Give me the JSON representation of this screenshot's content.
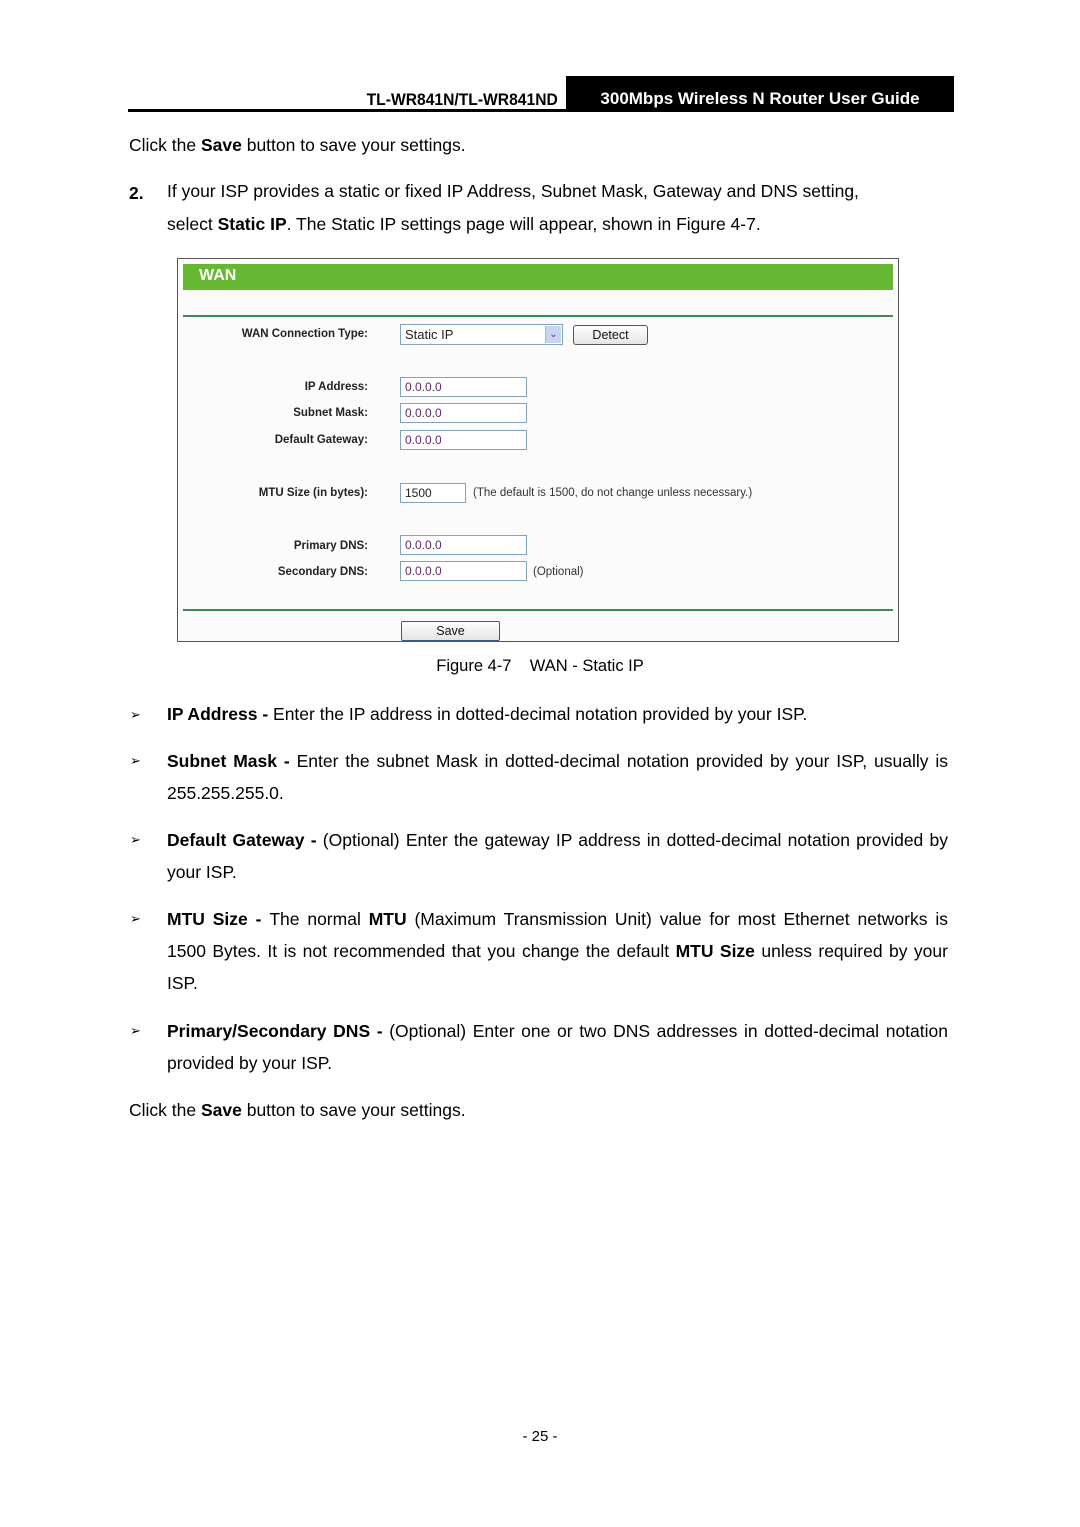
{
  "header": {
    "model": "TL-WR841N/TL-WR841ND",
    "guide_title": "300Mbps Wireless N Router User Guide"
  },
  "intro": {
    "save_line": [
      "Click the ",
      "Save",
      " button to save your settings."
    ],
    "step_number": "2.",
    "step_text_1": "If your ISP provides a static or fixed IP Address, Subnet Mask, Gateway and DNS setting,",
    "step_text_2_pre": "select ",
    "step_text_2_bold": "Static IP",
    "step_text_2_post": ". The Static IP settings page will appear, shown in Figure 4-7."
  },
  "figure": {
    "panel_title": "WAN",
    "brand_color": "#66b832",
    "connection_type_label": "WAN Connection Type:",
    "connection_type_value": "Static IP",
    "detect_label": "Detect",
    "fields": [
      {
        "label": "IP Address:",
        "value": "0.0.0.0"
      },
      {
        "label": "Subnet Mask:",
        "value": "0.0.0.0"
      },
      {
        "label": "Default Gateway:",
        "value": "0.0.0.0"
      },
      {
        "label": "MTU Size (in bytes):",
        "value": "1500",
        "hint": "(The default is 1500, do not change unless necessary.)"
      },
      {
        "label": "Primary DNS:",
        "value": "0.0.0.0"
      },
      {
        "label": "Secondary DNS:",
        "value": "0.0.0.0",
        "hint": "(Optional)"
      }
    ],
    "save_label": "Save",
    "caption": "Figure 4-7    WAN - Static IP"
  },
  "bullets": [
    {
      "term": "IP Address - ",
      "text": "Enter the IP address in dotted-decimal notation provided by your ISP."
    },
    {
      "term": "Subnet Mask - ",
      "text": "Enter the subnet Mask in dotted-decimal notation provided by your ISP, usually is 255.255.255.0."
    },
    {
      "term": "Default Gateway - ",
      "text": "(Optional) Enter the gateway IP address in dotted-decimal notation provided by your ISP."
    },
    {
      "term": "MTU Size - ",
      "text_1": "The normal ",
      "bold_1": "MTU",
      "text_2": " (Maximum Transmission Unit) value for most Ethernet networks is 1500 Bytes. It is not recommended that you change the default ",
      "bold_2": "MTU Size",
      "text_3": " unless required by your ISP."
    },
    {
      "term": "Primary/Secondary DNS - ",
      "text": "(Optional) Enter one or two DNS addresses in dotted-decimal notation provided by your ISP."
    }
  ],
  "closing": [
    "Click the ",
    "Save",
    " button to save your settings."
  ],
  "footer": {
    "page_number": "- 25 -"
  },
  "bullet_glyph": "➢"
}
